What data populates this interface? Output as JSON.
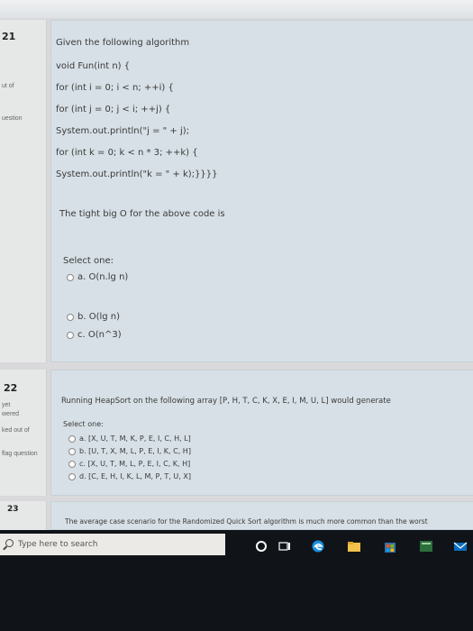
{
  "sidebar": {
    "q21_number": "21",
    "q21_out_of": "ut of",
    "q21_flag": "uestion",
    "q22_number": "22",
    "q22_status_1": "yet",
    "q22_status_2": "wered",
    "q22_marked": "ked out of",
    "q22_flag": "flag question",
    "q23_number": "23"
  },
  "question21": {
    "intro": "Given the following algorithm",
    "code": [
      "void Fun(int n) {",
      "for (int i = 0; i < n; ++i) {",
      "for (int j = 0; j < i; ++j) {",
      "System.out.println(\"j = \" + j);",
      "for (int k = 0; k < n * 3; ++k) {",
      "System.out.println(\"k = \" + k);}}}}"
    ],
    "prompt": "The tight big O for the above code is",
    "select_label": "Select one:",
    "options": [
      "a. O(n.lg n)",
      "b. O(lg n)",
      "c. O(n^3)"
    ]
  },
  "question22": {
    "prompt": "Running HeapSort on the following array [P, H, T, C, K, X, E, I, M, U, L] would generate",
    "select_label": "Select one:",
    "options": [
      "a. [X, U, T, M, K, P, E, I, C, H, L]",
      "b. [U, T, X, M, L, P, E, I, K, C, H]",
      "c. [X, U, T, M, L, P, E, I, C, K, H]",
      "d. [C, E, H, I, K, L, M, P, T, U, X]"
    ]
  },
  "question23": {
    "prompt": "The average case scenario for the Randomized Quick Sort algorithm is much more common than the worst"
  },
  "taskbar": {
    "search_placeholder": "Type here to search",
    "icons": [
      "cortana-circle-icon",
      "task-view-icon",
      "edge-icon",
      "file-explorer-icon",
      "store-icon",
      "app-icon",
      "mail-icon"
    ]
  }
}
